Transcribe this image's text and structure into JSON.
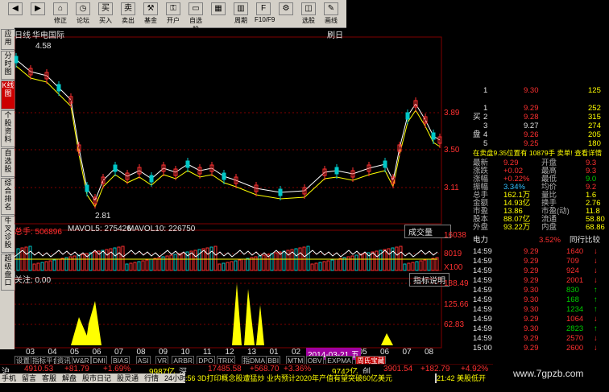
{
  "toolbar": {
    "buttons": [
      {
        "label": "",
        "icon": "back-icon"
      },
      {
        "label": "",
        "icon": "forward-icon"
      },
      {
        "label": "修正",
        "icon": "house-icon"
      },
      {
        "label": "论坛",
        "icon": "clock-icon"
      },
      {
        "label": "买入",
        "icon": "buy-icon"
      },
      {
        "label": "卖出",
        "icon": "sell-icon"
      },
      {
        "label": "基金",
        "icon": "hammer-icon"
      },
      {
        "label": "开户",
        "icon": "key-icon"
      },
      {
        "label": "自选股",
        "icon": "monitor-icon"
      },
      {
        "label": "",
        "icon": "grid-icon"
      },
      {
        "label": "周期",
        "icon": "bar-icon"
      },
      {
        "label": "F10/F9",
        "icon": "f10-icon"
      },
      {
        "label": "",
        "icon": "gear-icon"
      },
      {
        "label": "选股",
        "icon": "chart-icon"
      },
      {
        "label": "画线",
        "icon": "pencil-icon"
      }
    ]
  },
  "left_tabs": [
    "应用",
    "分时图",
    "K线图",
    "个股资料",
    "自选股",
    "综合排名",
    "牛叉诊股",
    "超级盘口"
  ],
  "chart": {
    "period": "日线",
    "stock_name": "华电国际",
    "refresh_label": "刷日",
    "price_high_label": "4.58",
    "price_low_label": "2.81",
    "price_scale": [
      "3.89",
      "3.50",
      "3.11"
    ],
    "volume_title": "总手: 506896",
    "mavol5": "MAVOL5: 275426",
    "mavol10": "MAVOL10: 226750",
    "volume_selector": "成交量",
    "volume_scale": [
      "16038",
      "8019",
      "X100"
    ],
    "indicator_title": "关注: 0.00",
    "indicator_help": "指标说明",
    "indicator_scale": [
      "188.49",
      "125.66",
      "62.83"
    ],
    "x_ticks": [
      "03",
      "04",
      "05",
      "06",
      "07",
      "08",
      "09",
      "10",
      "11",
      "12",
      "13",
      "01",
      "02",
      "03",
      "04",
      "05",
      "06",
      "07",
      "08"
    ],
    "date_tag": "2014-03-21 五",
    "indicator_tabs": [
      "设置",
      "指标平台",
      "资讯",
      "W&R",
      "DMI",
      "BIAS",
      "ASI",
      "VR",
      "ARBR",
      "DPO",
      "TRIX",
      "指DMA",
      "BBI",
      "MTM",
      "OBV",
      "EXPMA",
      "周氏宝藏"
    ]
  },
  "panel": {
    "buy_label": "买",
    "pan_label": "盘",
    "order_book": [
      {
        "level": "1",
        "price": "9.29",
        "vol": "252"
      },
      {
        "level": "2",
        "price": "9.28",
        "vol": "315"
      },
      {
        "level": "3",
        "price": "9.27",
        "vol": "274"
      },
      {
        "level": "4",
        "price": "9.26",
        "vol": "205"
      },
      {
        "level": "5",
        "price": "9.25",
        "vol": "180"
      }
    ],
    "top_row": {
      "level": "1",
      "price": "9.30",
      "vol": "125"
    },
    "info_line": "在卖盘9.35位置有 10879手 卖单! 查看详情",
    "stats": [
      {
        "k1": "最新",
        "v1": "9.29",
        "k2": "开盘",
        "v2": "9.3"
      },
      {
        "k1": "涨跌",
        "v1": "+0.02",
        "k2": "最高",
        "v2": "9.3"
      },
      {
        "k1": "涨幅",
        "v1": "+0.22%",
        "k2": "最低",
        "v2": "9.0"
      },
      {
        "k1": "振幅",
        "v1": "3.34%",
        "k2": "均价",
        "v2": "9.2"
      },
      {
        "k1": "总手",
        "v1": "162.1万",
        "k2": "量比",
        "v2": "1.6"
      },
      {
        "k1": "金额",
        "v1": "14.93亿",
        "k2": "换手",
        "v2": "2.76"
      },
      {
        "k1": "市盈",
        "v1": "13.86",
        "k2": "市盈(动)",
        "v2": "11.8"
      },
      {
        "k1": "股本",
        "v1": "88.07亿",
        "k2": "流通",
        "v2": "58.80"
      },
      {
        "k1": "外盘",
        "v1": "93.22万",
        "k2": "内盘",
        "v2": "68.86"
      }
    ],
    "industry": {
      "name": "电力",
      "change": "3.52%",
      "link": "同行比较"
    },
    "ticks": [
      {
        "time": "14:59",
        "price": "9.29",
        "vol": "1640",
        "dir": "down"
      },
      {
        "time": "14:59",
        "price": "9.29",
        "vol": "709",
        "dir": "down"
      },
      {
        "time": "14:59",
        "price": "9.29",
        "vol": "924",
        "dir": "down"
      },
      {
        "time": "14:59",
        "price": "9.29",
        "vol": "2001",
        "dir": "down"
      },
      {
        "time": "14:59",
        "price": "9.30",
        "vol": "830",
        "dir": "up"
      },
      {
        "time": "14:59",
        "price": "9.30",
        "vol": "168",
        "dir": "up"
      },
      {
        "time": "14:59",
        "price": "9.30",
        "vol": "1234",
        "dir": "up"
      },
      {
        "time": "14:59",
        "price": "9.29",
        "vol": "1064",
        "dir": "down"
      },
      {
        "time": "14:59",
        "price": "9.30",
        "vol": "2823",
        "dir": "up"
      },
      {
        "time": "14:59",
        "price": "9.29",
        "vol": "2570",
        "dir": "down"
      },
      {
        "time": "15:00",
        "price": "9.29",
        "vol": "2600",
        "dir": "down"
      }
    ]
  },
  "status": {
    "sh_label": "沪",
    "sh_index": "4910.53",
    "sh_change": "+81.79",
    "sh_pct": "+1.69%",
    "sh_amount": "9987亿",
    "sz_label": "深",
    "sz_index": "17485.58",
    "sz_change": "+568.70",
    "sz_pct": "+3.36%",
    "sz_amount": "9742亿",
    "cy_label": "创",
    "cy_index": "3901.54",
    "cy_change": "+182.79",
    "cy_pct": "+4.92%"
  },
  "taskbar": {
    "items": [
      "手机",
      "留言",
      "客服",
      "解盘",
      "股市日记",
      "股灵通",
      "行情",
      "24小时滚动"
    ],
    "news": ":56 3D打印概念股遭猛炒 业内预计2020年产值有望突破60亿美元",
    "news_right": "21:42 美股低开"
  },
  "watermark": "www.7gpzb.com",
  "colors": {
    "up": "#ff3030",
    "down": "#00d000",
    "price_line": "#ff3030",
    "indicator_fill": "#ffff00",
    "grid": "#800000"
  }
}
